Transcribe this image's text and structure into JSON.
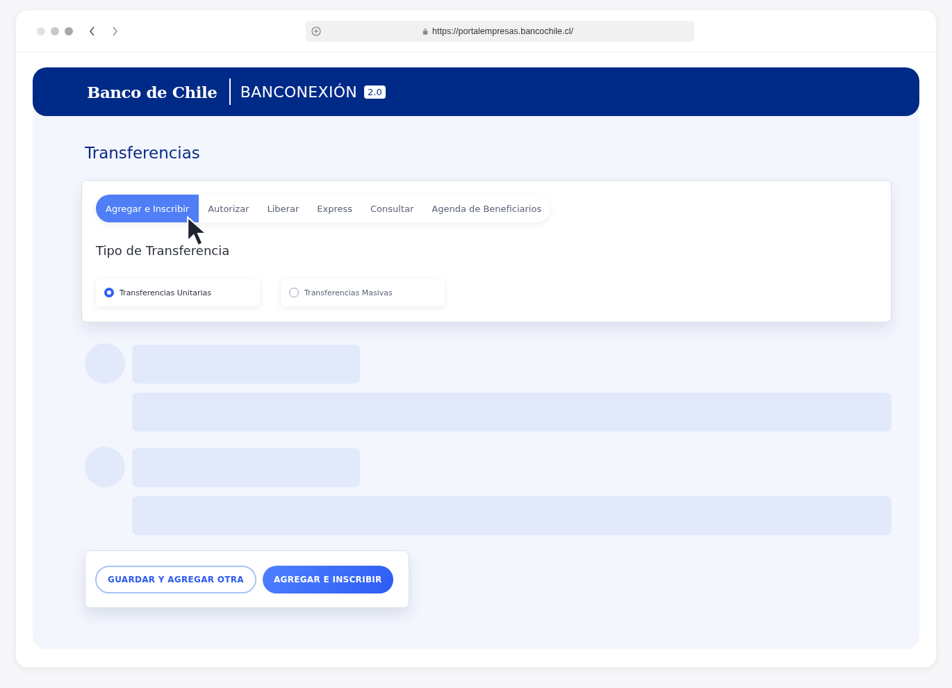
{
  "browser": {
    "url": "https://portalempresas.bancochile.cl/"
  },
  "header": {
    "logo": "Banco de Chile",
    "product": "BANCONEXIÓN",
    "version": "2.0"
  },
  "page": {
    "title": "Transferencias"
  },
  "tabs": [
    {
      "label": "Agregar e Inscribir",
      "selected": true
    },
    {
      "label": "Autorizar",
      "selected": false
    },
    {
      "label": "Liberar",
      "selected": false
    },
    {
      "label": "Express",
      "selected": false
    },
    {
      "label": "Consultar",
      "selected": false
    },
    {
      "label": "Agenda de Beneficiarios",
      "selected": false
    }
  ],
  "section": {
    "title": "Tipo de Transferencia"
  },
  "transfer_types": [
    {
      "label": "Transferencias Unitarias",
      "selected": true
    },
    {
      "label": "Transferencias Masivas",
      "selected": false
    }
  ],
  "buttons": [
    {
      "label": "GUARDAR Y AGREGAR OTRA",
      "kind": "outline"
    },
    {
      "label": "AGREGAR E INSCRIBIR",
      "kind": "primary"
    }
  ]
}
